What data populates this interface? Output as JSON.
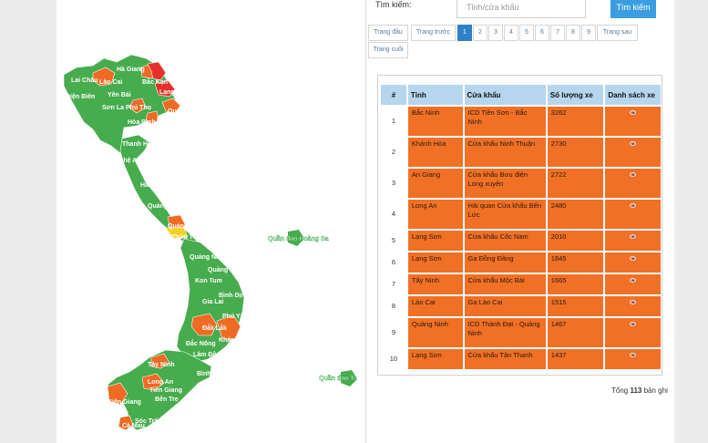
{
  "search": {
    "label": "Tìm kiếm:",
    "placeholder": "Tỉnh/cửa khẩu",
    "button": "Tìm kiếm"
  },
  "pagination": {
    "first": "Trang đầu",
    "prev": "Trang trước",
    "pages": [
      "1",
      "2",
      "3",
      "4",
      "5",
      "6",
      "7",
      "8",
      "9"
    ],
    "active_page": "1",
    "next": "Trang sau",
    "last": "Trang cuối"
  },
  "table": {
    "headers": [
      "#",
      "Tỉnh",
      "Cửa khẩu",
      "Số lượng xe",
      "Danh sách xe"
    ],
    "rows": [
      {
        "idx": "1",
        "province": "Bắc Ninh",
        "gate": "ICD Tiên Sơn - Bắc Ninh",
        "count": "3262"
      },
      {
        "idx": "2",
        "province": "Khánh Hòa",
        "gate": "Cửa khẩu Ninh Thuận",
        "count": "2730"
      },
      {
        "idx": "3",
        "province": "An Giang",
        "gate": "Cửa khẩu Bưu điện Long xuyên",
        "count": "2722"
      },
      {
        "idx": "4",
        "province": "Long An",
        "gate": "Hải quan Cửa khẩu Bến Lức",
        "count": "2480"
      },
      {
        "idx": "5",
        "province": "Lạng Sơn",
        "gate": "Cửa khẩu Cốc Nam",
        "count": "2010"
      },
      {
        "idx": "6",
        "province": "Lạng Sơn",
        "gate": "Ga Đồng Đăng",
        "count": "1845"
      },
      {
        "idx": "7",
        "province": "Tây Ninh",
        "gate": "Cửa khẩu Mộc Bài",
        "count": "1665"
      },
      {
        "idx": "8",
        "province": "Lào Cai",
        "gate": "Ga Lào Cai",
        "count": "1515"
      },
      {
        "idx": "9",
        "province": "Quảng Ninh",
        "gate": "ICD Thành Đạt - Quảng Ninh",
        "count": "1467"
      },
      {
        "idx": "10",
        "province": "Lạng Sơn",
        "gate": "Cửa khẩu Tân Thanh",
        "count": "1437"
      }
    ]
  },
  "total": {
    "prefix": "Tổng",
    "count": "113",
    "suffix": "bản ghi"
  },
  "map": {
    "province_labels": [
      "Hà Giang",
      "Lai Châu",
      "Lào Cai",
      "Bắc Kạn",
      "Điện Biên",
      "Yên Bái",
      "Lạng Sơn",
      "Sơn La",
      "Phú Thọ",
      "Quảng Ninh",
      "Hòa Bình",
      "Hải Phòng",
      "Thanh Hóa",
      "Nghệ An",
      "Hà Tĩnh",
      "Quảng Bình",
      "Quảng Trị",
      "Thừa Thiên - Huế",
      "Quảng Nam",
      "Quảng Ngãi",
      "Kon Tum",
      "Bình Định",
      "Gia Lai",
      "Phú Yên",
      "Đắk Lắk",
      "Khánh Hòa",
      "Đắc Nông",
      "Lâm Đồng",
      "Tây Ninh",
      "Bình Thuận",
      "Long An",
      "Tiền Giang",
      "Kiên Giang",
      "Bến Tre",
      "Sóc Trăng",
      "Cà Mau"
    ],
    "island_labels": [
      "Quần đảo Hoàng Sa",
      "Quần đảo Tr"
    ]
  },
  "colors": {
    "map_green": "#46ac4e",
    "map_orange": "#ef6a22",
    "map_red": "#e8302a",
    "map_yellow": "#f5d020",
    "row_orange": "#f07026",
    "header_blue": "#b6d6ee",
    "button_blue": "#3c9ee0",
    "active_page": "#2f80c7"
  }
}
